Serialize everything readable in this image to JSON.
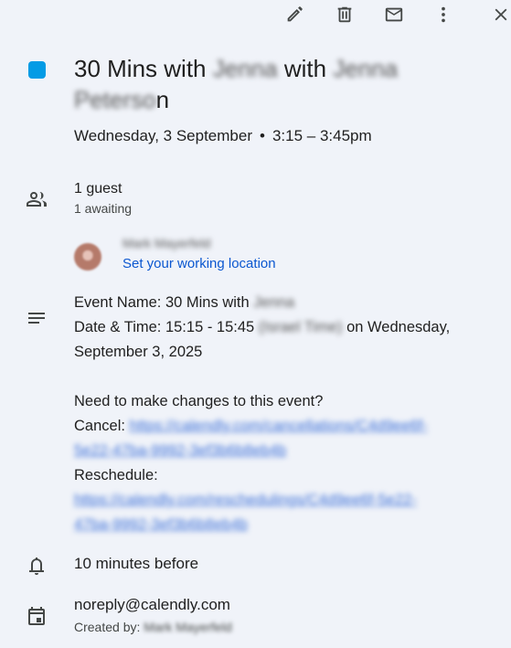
{
  "toolbar": {
    "edit_icon": "pencil-icon",
    "delete_icon": "trash-icon",
    "email_icon": "mail-icon",
    "more_icon": "more-vert-icon",
    "close_icon": "close-icon"
  },
  "event": {
    "color": "#039be5",
    "title_part1": "30 Mins with",
    "title_blur1": "Jenna",
    "title_part2": "with",
    "title_blur2": "Jenna",
    "title_blur3": "Peterso",
    "title_tail": "n",
    "date": "Wednesday, 3 September",
    "time": "3:15 – 3:45pm"
  },
  "guests": {
    "count_label": "1 guest",
    "awaiting_label": "1 awaiting",
    "guest_name": "Mark Mayerfeld",
    "working_location_link": "Set your working location"
  },
  "description": {
    "line1_label": "Event Name: 30 Mins with",
    "line1_blur": "Jenna",
    "line2_label": "Date & Time: 15:15 - 15:45",
    "line2_blur": "(Israel Time)",
    "line2_tail": "on Wednesday,",
    "line3": "September 3, 2025",
    "changes_question": "Need to make changes to this event?",
    "cancel_label": "Cancel:",
    "cancel_url_1": "https://calendly.com/cancellations/C4d9ee6f-",
    "cancel_url_2": "5e22-47ba-9992-3ef3b6b8eb4b",
    "reschedule_label": "Reschedule:",
    "reschedule_url_1": "https://calendly.com/reschedulings/C4d9ee6f-5e22-",
    "reschedule_url_2": "47ba-9992-3ef3b6b8eb4b"
  },
  "reminder": {
    "label": "10 minutes before"
  },
  "organizer": {
    "calendar": "noreply@calendly.com",
    "created_by_label": "Created by:",
    "created_by_name": "Mark Mayerfeld"
  }
}
